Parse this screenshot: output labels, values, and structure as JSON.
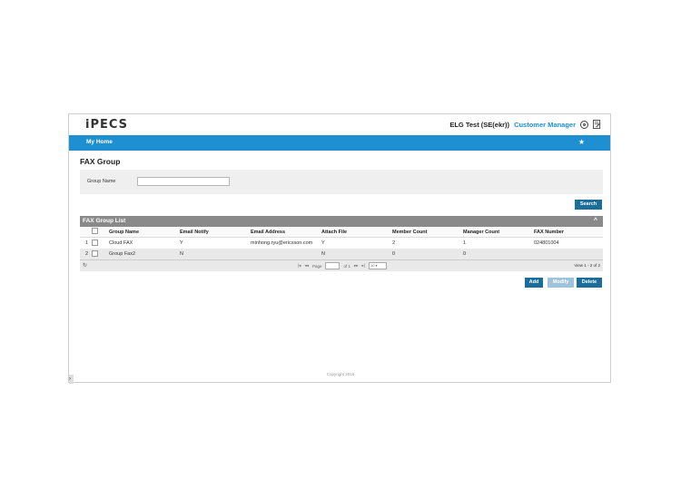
{
  "header": {
    "logo": "iPECS",
    "org": "ELG Test (SE(ekr))",
    "role": "Customer Manager",
    "icons": [
      "settings-circle-icon",
      "document-edit-icon"
    ]
  },
  "nav": {
    "home": "My Home",
    "star_icon": "★"
  },
  "page": {
    "title": "FAX Group"
  },
  "search": {
    "label": "Group Name",
    "value": "",
    "button": "Search"
  },
  "grid": {
    "caption": "FAX Group List",
    "columns": [
      "Group Name",
      "Email Notify",
      "Email Address",
      "Attach File",
      "Member Count",
      "Manager Count",
      "FAX Number"
    ],
    "rows": [
      {
        "num": "1",
        "group_name": "Cloud FAX",
        "email_notify": "Y",
        "email_address": "minhong.ryu@ericsson.com",
        "attach_file": "Y",
        "member_count": "2",
        "manager_count": "1",
        "fax_number": "024801004"
      },
      {
        "num": "2",
        "group_name": "Group Fax2",
        "email_notify": "N",
        "email_address": "",
        "attach_file": "N",
        "member_count": "0",
        "manager_count": "0",
        "fax_number": ""
      }
    ],
    "pager": {
      "page_label": "Page",
      "page_value": "1",
      "of_label": "of 1",
      "rows_per_page": "10",
      "view_text": "View 1 - 2 of 2"
    }
  },
  "actions": {
    "add": "Add",
    "modify": "Modify",
    "delete": "Delete"
  },
  "footer": {
    "copyright": "Copyright 2016"
  }
}
